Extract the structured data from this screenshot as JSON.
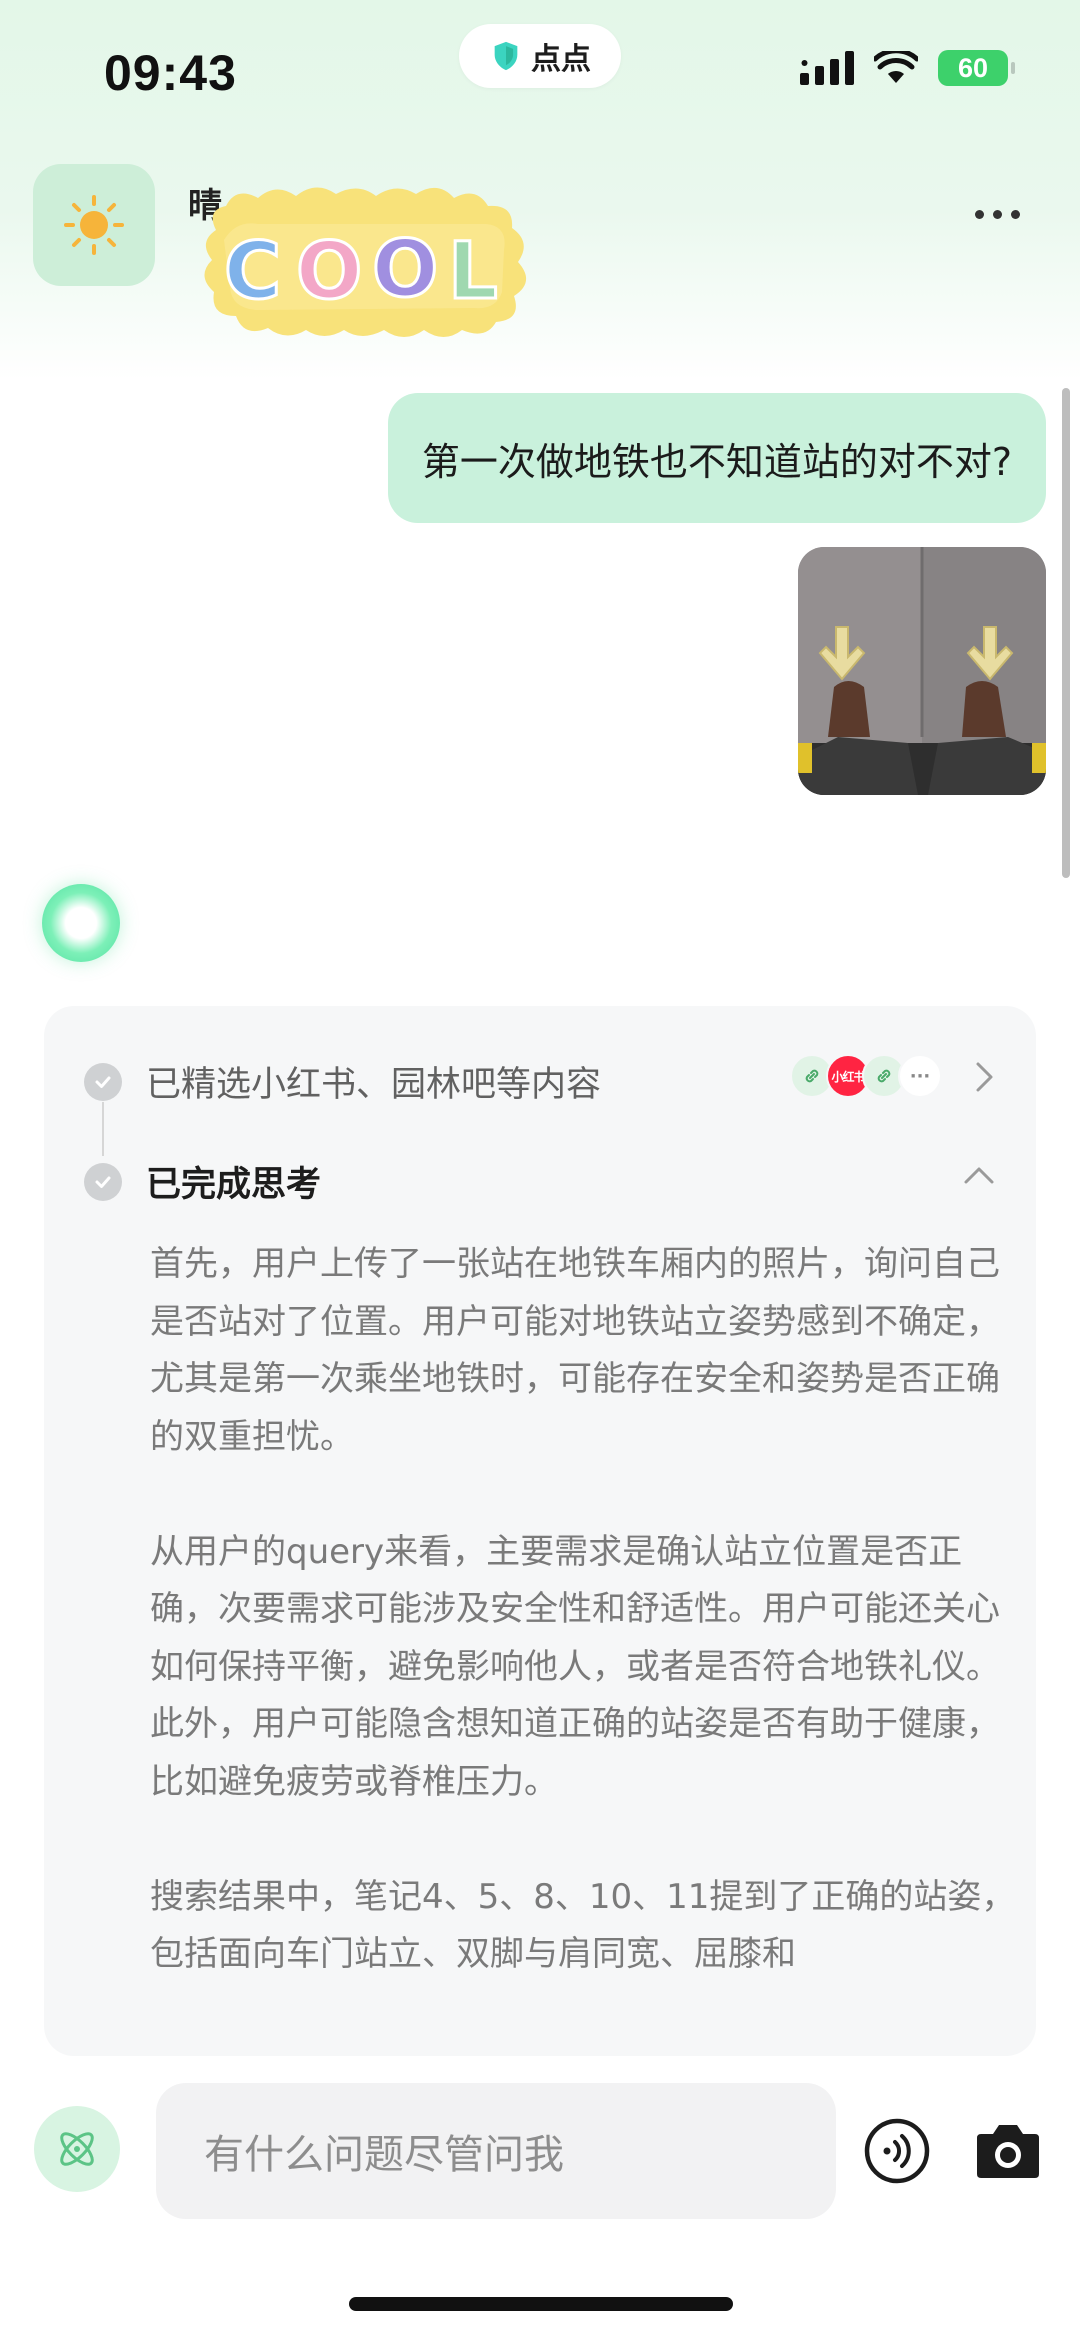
{
  "status_bar": {
    "time": "09:43",
    "app_pill": "点点",
    "battery": "60"
  },
  "header": {
    "weather_text": "晴 · ",
    "sticker_text": "COOL",
    "icons": {
      "weather": "sun-icon",
      "more": "more-dots-icon"
    }
  },
  "chat": {
    "user_message": "第一次做地铁也不知道站的对不对?",
    "user_photo": "photo-thumbnail"
  },
  "thinking_card": {
    "step1_label": "已精选小红书、园林吧等内容",
    "step2_label": "已完成思考",
    "source_badges": [
      "link",
      "小红书",
      "link",
      "···"
    ],
    "paragraphs": [
      "首先，用户上传了一张站在地铁车厢内的照片，询问自己是否站对了位置。用户可能对地铁站立姿势感到不确定，尤其是第一次乘坐地铁时，可能存在安全和姿势是否正确的双重担忧。",
      "从用户的query来看，主要需求是确认站立位置是否正确，次要需求可能涉及安全性和舒适性。用户可能还关心如何保持平衡，避免影响他人，或者是否符合地铁礼仪。此外，用户可能隐含想知道正确的站姿是否有助于健康，比如避免疲劳或脊椎压力。",
      "搜索结果中，笔记4、5、8、10、11提到了正确的站姿，包括面向车门站立、双脚与肩同宽、屈膝和"
    ]
  },
  "input_bar": {
    "placeholder": "有什么问题尽管问我"
  },
  "colors": {
    "accent": "#3dd16b",
    "user_bubble": "#c9f1dc",
    "card_bg": "#f6f7f8"
  }
}
